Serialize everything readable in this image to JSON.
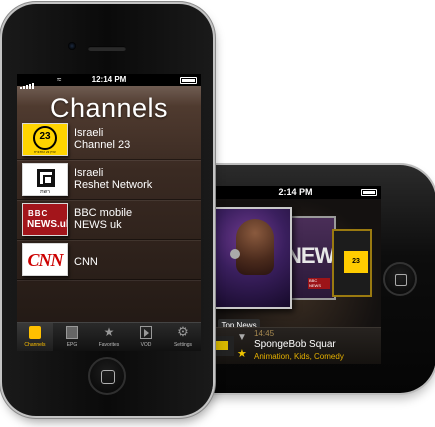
{
  "landscape": {
    "status_time": "2:14 PM",
    "featured_card_label": "Top News",
    "news_card_text": "NEWS",
    "news_card_mini": "BBC NEWS",
    "now_playing": {
      "time": "14:45",
      "title": "SpongeBob Squar",
      "subtitle": "Animation, Kids, Comedy"
    }
  },
  "portrait": {
    "status_time": "12:14 PM",
    "title": "Channels",
    "channels": [
      {
        "line1": "Israeli",
        "line2": "Channel 23",
        "logo_text": "23",
        "logo_sub": "ערוץ 23 החינוכית"
      },
      {
        "line1": "Israeli",
        "line2": "Reshet Network",
        "logo_text": "רשת"
      },
      {
        "line1": "BBC mobile",
        "line2": "NEWS uk",
        "logo_text": "BBC",
        "logo_sub": "NEWS.uk"
      },
      {
        "line1": "",
        "line2": "CNN",
        "logo_text": "CNN"
      }
    ],
    "tabs": [
      {
        "label": "Channels",
        "icon": "phone-icon",
        "active": true
      },
      {
        "label": "EPG",
        "icon": "epg-icon",
        "active": false
      },
      {
        "label": "Favorites",
        "icon": "star-icon",
        "active": false
      },
      {
        "label": "VOD",
        "icon": "film-icon",
        "active": false
      },
      {
        "label": "Settings",
        "icon": "gear-icon",
        "active": false
      }
    ],
    "accent_color": "#ffc000"
  }
}
